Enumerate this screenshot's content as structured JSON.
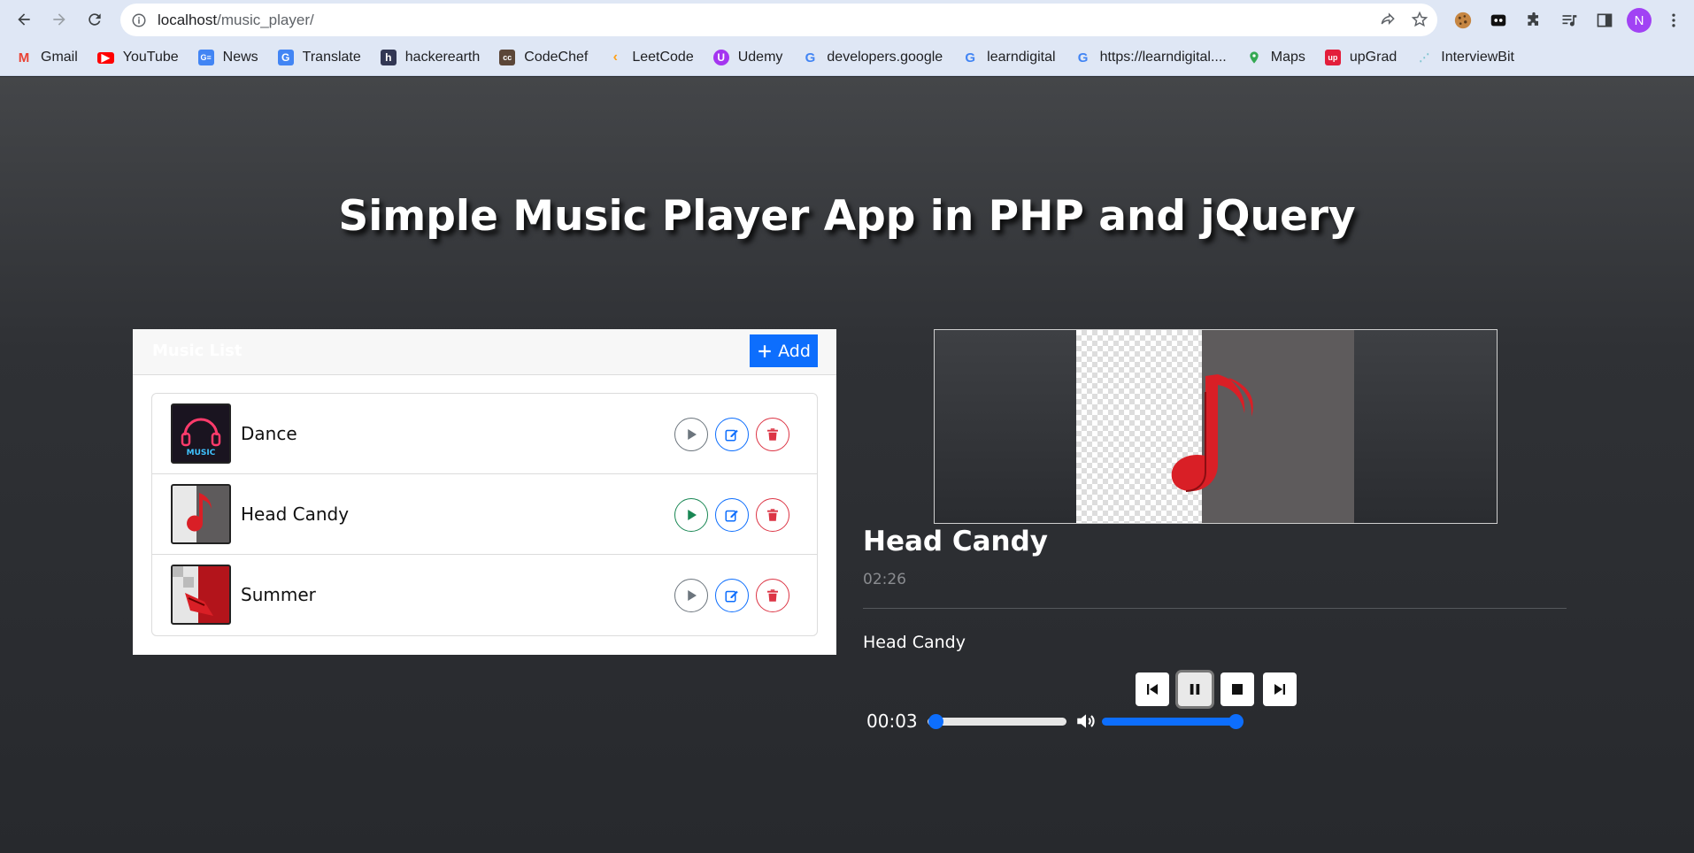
{
  "browser": {
    "url_host": "localhost",
    "url_path": "/music_player/",
    "avatar_initial": "N",
    "bookmarks": [
      {
        "label": "Gmail",
        "icon": "gmail-icon",
        "color": "#ea4335"
      },
      {
        "label": "YouTube",
        "icon": "youtube-icon",
        "color": "#ff0000"
      },
      {
        "label": "News",
        "icon": "news-icon",
        "color": "#4285f4"
      },
      {
        "label": "Translate",
        "icon": "translate-icon",
        "color": "#4285f4"
      },
      {
        "label": "hackerearth",
        "icon": "hackerearth-icon",
        "color": "#323754"
      },
      {
        "label": "CodeChef",
        "icon": "codechef-icon",
        "color": "#5b4638"
      },
      {
        "label": "LeetCode",
        "icon": "leetcode-icon",
        "color": "#ffa116"
      },
      {
        "label": "Udemy",
        "icon": "udemy-icon",
        "color": "#a435f0"
      },
      {
        "label": "developers.google",
        "icon": "google-icon",
        "color": "#4285f4"
      },
      {
        "label": "learndigital",
        "icon": "google-icon",
        "color": "#4285f4"
      },
      {
        "label": "https://learndigital....",
        "icon": "google-icon",
        "color": "#4285f4"
      },
      {
        "label": "Maps",
        "icon": "maps-icon",
        "color": "#34a853"
      },
      {
        "label": "upGrad",
        "icon": "upgrad-icon",
        "color": "#e31e3b"
      },
      {
        "label": "InterviewBit",
        "icon": "interviewbit-icon",
        "color": "#7ec4cf"
      }
    ]
  },
  "page": {
    "title": "Simple Music Player App in PHP and jQuery"
  },
  "music_list": {
    "header": "Music List",
    "add_label": "Add",
    "songs": [
      {
        "name": "Dance",
        "playing": false
      },
      {
        "name": "Head Candy",
        "playing": true
      },
      {
        "name": "Summer",
        "playing": false
      }
    ]
  },
  "player": {
    "title": "Head Candy",
    "duration": "02:26",
    "description": "Head Candy",
    "current_time": "00:03",
    "seek_fraction": 0.02,
    "volume_fraction": 1.0
  }
}
